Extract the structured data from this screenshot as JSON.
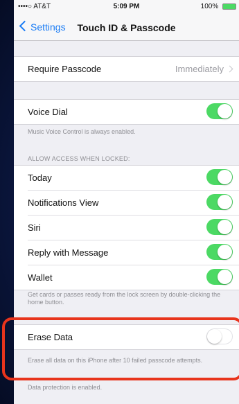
{
  "status_bar": {
    "carrier": "••••○ AT&T",
    "time": "5:09 PM",
    "battery": "100%"
  },
  "nav": {
    "back_label": "Settings",
    "title": "Touch ID & Passcode"
  },
  "require_passcode": {
    "label": "Require Passcode",
    "value": "Immediately"
  },
  "voice_dial": {
    "label": "Voice Dial",
    "on": true,
    "note": "Music Voice Control is always enabled."
  },
  "locked_section": {
    "header": "ALLOW ACCESS WHEN LOCKED:",
    "items": [
      {
        "label": "Today",
        "on": true
      },
      {
        "label": "Notifications View",
        "on": true
      },
      {
        "label": "Siri",
        "on": true
      },
      {
        "label": "Reply with Message",
        "on": true
      },
      {
        "label": "Wallet",
        "on": true
      }
    ],
    "note": "Get cards or passes ready from the lock screen by double-clicking the home button."
  },
  "erase_data": {
    "label": "Erase Data",
    "on": false,
    "note": "Erase all data on this iPhone after 10 failed passcode attempts.",
    "footer": "Data protection is enabled."
  },
  "colors": {
    "accent": "#1a7cf5",
    "toggle_on": "#4cd964",
    "highlight": "#e8341c"
  }
}
